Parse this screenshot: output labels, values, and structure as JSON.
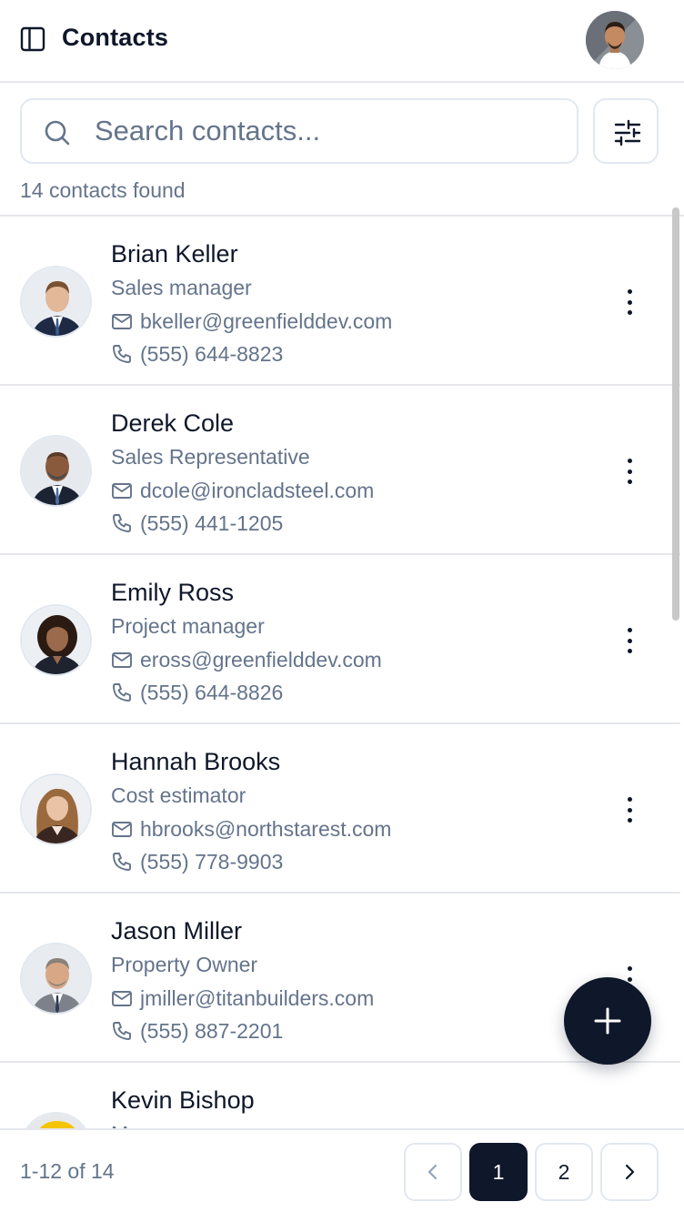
{
  "header": {
    "title": "Contacts",
    "sidebar_toggle_icon": "sidebar-panel-icon",
    "avatar_icon": "user-avatar"
  },
  "search": {
    "placeholder": "Search contacts...",
    "value": "",
    "filter_icon": "sliders-icon"
  },
  "result_count": "14 contacts found",
  "contacts": [
    {
      "name": "Brian Keller",
      "role": "Sales manager",
      "email": "bkeller@greenfielddev.com",
      "phone": "(555) 644-8823"
    },
    {
      "name": "Derek Cole",
      "role": "Sales Representative",
      "email": "dcole@ironcladsteel.com",
      "phone": "(555) 441-1205"
    },
    {
      "name": "Emily Ross",
      "role": "Project manager",
      "email": "eross@greenfielddev.com",
      "phone": "(555) 644-8826"
    },
    {
      "name": "Hannah Brooks",
      "role": "Cost estimator",
      "email": "hbrooks@northstarest.com",
      "phone": "(555) 778-9903"
    },
    {
      "name": "Jason Miller",
      "role": "Property Owner",
      "email": "jmiller@titanbuilders.com",
      "phone": "(555) 887-2201"
    },
    {
      "name": "Kevin Bishop",
      "role": "Manager",
      "email": "",
      "phone": ""
    }
  ],
  "fab": {
    "icon": "plus-icon"
  },
  "pagination": {
    "range": "1-12 of 14",
    "pages": [
      "1",
      "2"
    ],
    "current": "1"
  },
  "colors": {
    "primary": "#0f172a",
    "muted_text": "#64748b",
    "border": "#e2e8f0"
  }
}
